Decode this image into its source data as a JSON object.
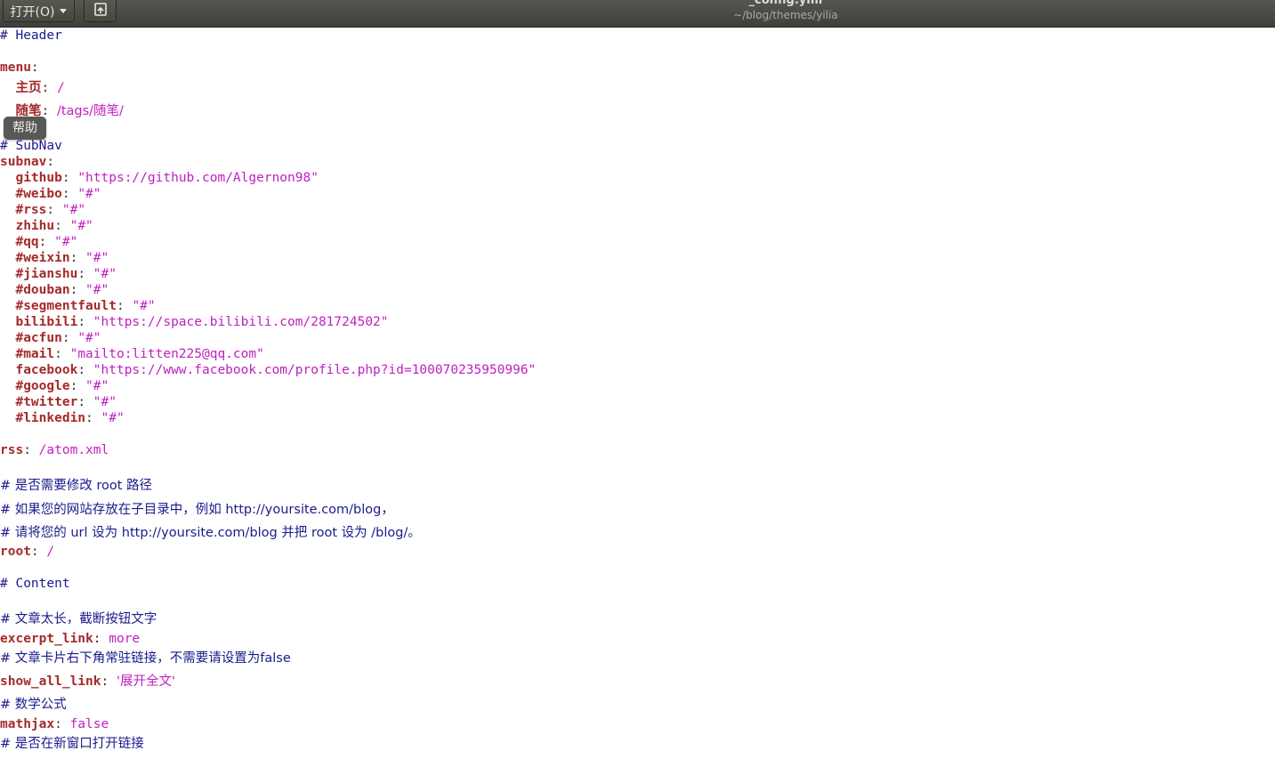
{
  "toolbar": {
    "open_label": "打开(O)",
    "save_icon": "save-document-icon"
  },
  "window": {
    "title": "_config.yml",
    "path": "~/blog/themes/yilia"
  },
  "tooltip": {
    "text": "帮助"
  },
  "editor": {
    "lines": {
      "l1_comment": "# Header",
      "l2_key": "menu",
      "l3_key": "主页",
      "l3_value": "/",
      "l4_key": "随笔",
      "l4_value": "/tags/随笔/",
      "l5_comment": "# SubNav",
      "l6_key": "subnav",
      "l7_key": "github",
      "l7_value": "\"https://github.com/Algernon98\"",
      "l8_key": "#weibo",
      "l8_value": "\"#\"",
      "l9_key": "#rss",
      "l9_value": "\"#\"",
      "l10_key": "zhihu",
      "l10_value": "\"#\"",
      "l11_key": "#qq",
      "l11_value": "\"#\"",
      "l12_key": "#weixin",
      "l12_value": "\"#\"",
      "l13_key": "#jianshu",
      "l13_value": "\"#\"",
      "l14_key": "#douban",
      "l14_value": "\"#\"",
      "l15_key": "#segmentfault",
      "l15_value": "\"#\"",
      "l16_key": "bilibili",
      "l16_value": "\"https://space.bilibili.com/281724502\"",
      "l17_key": "#acfun",
      "l17_value": "\"#\"",
      "l18_key": "#mail",
      "l18_value": "\"mailto:litten225@qq.com\"",
      "l19_key": "facebook",
      "l19_value": "\"https://www.facebook.com/profile.php?id=100070235950996\"",
      "l20_key": "#google",
      "l20_value": "\"#\"",
      "l21_key": "#twitter",
      "l21_value": "\"#\"",
      "l22_key": "#linkedin",
      "l22_value": "\"#\"",
      "l23_key": "rss",
      "l23_value": "/atom.xml",
      "l24_comment": "# 是否需要修改 root 路径",
      "l25_comment": "# 如果您的网站存放在子目录中，例如 http://yoursite.com/blog，",
      "l26_comment": "# 请将您的 url 设为 http://yoursite.com/blog 并把 root 设为 /blog/。",
      "l27_key": "root",
      "l27_value": "/",
      "l28_comment": "# Content",
      "l29_comment": "# 文章太长，截断按钮文字",
      "l30_key": "excerpt_link",
      "l30_value": "more",
      "l31_comment": "# 文章卡片右下角常驻链接，不需要请设置为false",
      "l32_key": "show_all_link",
      "l32_value": "'展开全文'",
      "l33_comment": "# 数学公式",
      "l34_key": "mathjax",
      "l34_value": "false",
      "l35_comment": "# 是否在新窗口打开链接"
    }
  },
  "colors": {
    "header_bg": "#4a4944",
    "key": "#a52a2a",
    "value": "#c020c0",
    "comment": "#1a1a8c"
  }
}
